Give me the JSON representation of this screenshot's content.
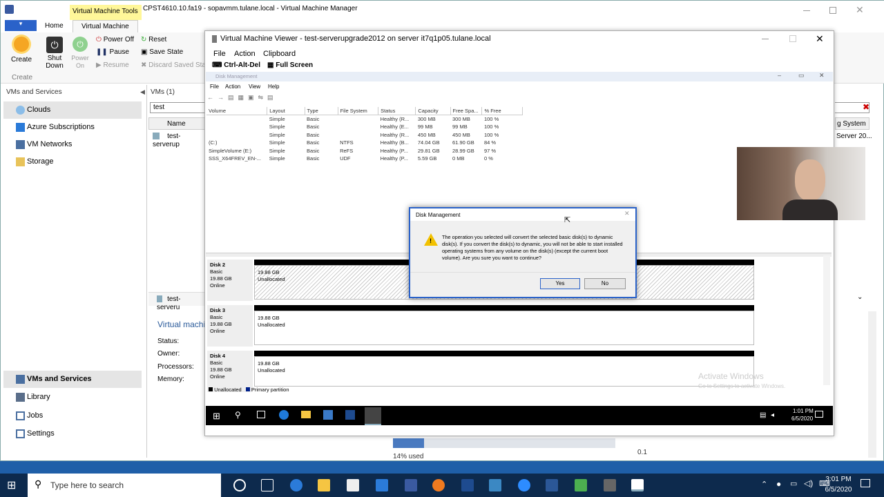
{
  "vmm": {
    "window_title": "CPST4610.10.fa19 - sopavmm.tulane.local - Virtual Machine Manager",
    "context_tab": "Virtual Machine Tools",
    "tabs": [
      "Home",
      "Virtual Machine"
    ],
    "ribbon": {
      "create": "Create",
      "shut_down": "Shut Down",
      "power_on": "Power On",
      "power_off": "Power Off",
      "pause": "Pause",
      "resume": "Resume",
      "reset": "Reset",
      "save_state": "Save State",
      "discard_saved_state": "Discard Saved Stat",
      "group_create": "Create"
    },
    "nav": {
      "header": "VMs and Services",
      "items": [
        "Clouds",
        "Azure Subscriptions",
        "VM Networks",
        "Storage"
      ],
      "workspaces": [
        "VMs and Services",
        "Library",
        "Jobs",
        "Settings"
      ]
    },
    "vms_panel": {
      "header": "VMs (1)",
      "search_value": "test",
      "col_name": "Name",
      "row_name": "test-serverup",
      "col_os": "g System",
      "row_os": "Server 20...",
      "detail_name": "test-serveru",
      "detail_title": "Virtual machin",
      "labels": [
        "Status:",
        "Owner:",
        "Processors:",
        "Memory:"
      ]
    },
    "storage": {
      "used_label": "14% used",
      "used_percent": 14,
      "value": "0.1"
    }
  },
  "viewer": {
    "title": "Virtual Machine Viewer - test-serverupgrade2012 on server it7q1p05.tulane.local",
    "menu": [
      "File",
      "Action",
      "Clipboard"
    ],
    "ctrl_alt_del": "Ctrl-Alt-Del",
    "full_screen": "Full Screen"
  },
  "disk_mgmt": {
    "title": "Disk Management",
    "menu": [
      "File",
      "Action",
      "View",
      "Help"
    ],
    "columns": [
      "Volume",
      "Layout",
      "Type",
      "File System",
      "Status",
      "Capacity",
      "Free Spa...",
      "% Free"
    ],
    "rows": [
      [
        "",
        "Simple",
        "Basic",
        "",
        "Healthy (R...",
        "300 MB",
        "300 MB",
        "100 %"
      ],
      [
        "",
        "Simple",
        "Basic",
        "",
        "Healthy (E...",
        "99 MB",
        "99 MB",
        "100 %"
      ],
      [
        "",
        "Simple",
        "Basic",
        "",
        "Healthy (R...",
        "450 MB",
        "450 MB",
        "100 %"
      ],
      [
        "(C:)",
        "Simple",
        "Basic",
        "NTFS",
        "Healthy (B...",
        "74.04 GB",
        "61.90 GB",
        "84 %"
      ],
      [
        "SimpleVolume (E:)",
        "Simple",
        "Basic",
        "ReFS",
        "Healthy (P...",
        "29.81 GB",
        "28.99 GB",
        "97 %"
      ],
      [
        "SSS_X64FREV_EN-...",
        "Simple",
        "Basic",
        "UDF",
        "Healthy (P...",
        "5.59 GB",
        "0 MB",
        "0 %"
      ]
    ],
    "disks": [
      {
        "name": "Disk 2",
        "type": "Basic",
        "size": "19.88 GB",
        "state": "Online",
        "part_size": "19.88 GB",
        "part_state": "Unallocated"
      },
      {
        "name": "Disk 3",
        "type": "Basic",
        "size": "19.88 GB",
        "state": "Online",
        "part_size": "19.88 GB",
        "part_state": "Unallocated"
      },
      {
        "name": "Disk 4",
        "type": "Basic",
        "size": "19.88 GB",
        "state": "Online",
        "part_size": "19.88 GB",
        "part_state": "Unallocated"
      }
    ],
    "legend": [
      "Unallocated",
      "Primary partition"
    ],
    "watermark_title": "Activate Windows",
    "watermark_sub": "Go to Settings to activate Windows."
  },
  "dialog": {
    "title": "Disk Management",
    "message": "The operation you selected will convert the selected basic disk(s) to dynamic disk(s). If you convert the disk(s) to dynamic, you will not be able to start installed operating systems from any volume on the disk(s) (except the current boot volume). Are you sure you want to continue?",
    "yes": "Yes",
    "no": "No"
  },
  "guest_taskbar": {
    "time": "1:01 PM",
    "date": "6/5/2020"
  },
  "host_taskbar": {
    "search_placeholder": "Type here to search",
    "time": "3:01 PM",
    "date": "6/5/2020"
  },
  "colors": {
    "ribbon_context": "#fff799",
    "accent": "#2a62c9",
    "taskbar": "#0d2a4d"
  }
}
